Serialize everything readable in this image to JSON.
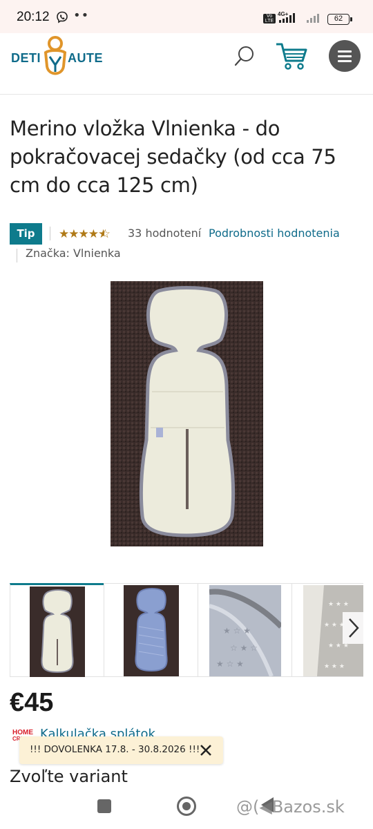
{
  "status_bar": {
    "time": "20:12",
    "network_label": "4G+",
    "volte": "Vo LTE",
    "battery": "62"
  },
  "header": {
    "logo_left": "DETI",
    "logo_right": "AUTE",
    "icons": [
      "search-icon",
      "cart-icon",
      "menu-icon"
    ],
    "brand_color": "#0f6b8a",
    "logo_mark_color": "#e0952a"
  },
  "product": {
    "title": "Merino vložka Vlnienka - do pokračovacej sedačky (od cca 75 cm do cca 125 cm)",
    "badge": "Tip",
    "rating_stars": 4.5,
    "reviews_count": "33 hodnotení",
    "rating_link": "Podrobnosti hodnotenia",
    "brand": "Značka: Vlnienka",
    "price": "€45",
    "calc_logo_top": "HOME",
    "calc_logo_bottom": "CREDIT",
    "calc_link": "Kalkulačka splátok",
    "variant_heading": "Zvoľte variant"
  },
  "gallery": {
    "thumbnail_count": 4,
    "active_index": 0,
    "accent_color": "#0e7b8c"
  },
  "banner": {
    "text": "!!! DOVOLENKA 17.8. - 30.8.2026 !!!",
    "background": "#fcf1d6"
  },
  "watermark": {
    "text": "@(◀Bazos.sk"
  }
}
